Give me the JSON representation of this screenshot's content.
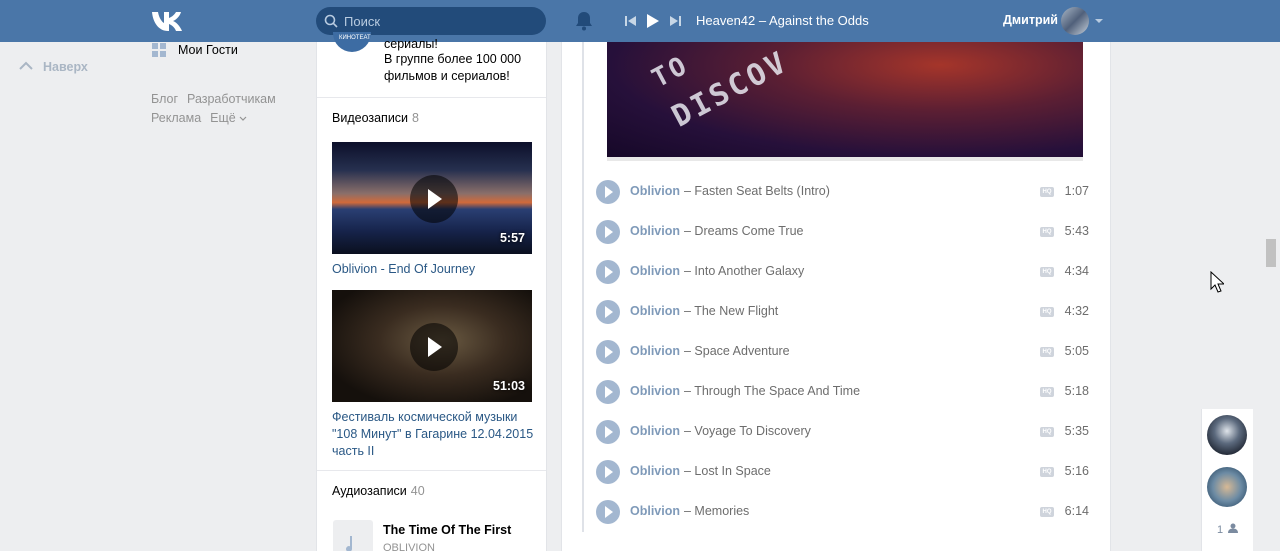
{
  "header": {
    "search_placeholder": "Поиск",
    "now_playing": "Heaven42 – Against the Odds",
    "user_name": "Дмитрий"
  },
  "left_nav": {
    "guests_label": "Мои Гости",
    "to_top_label": "Наверх",
    "footer_links": [
      "Блог",
      "Разработчикам",
      "Реклама",
      "Ещё"
    ]
  },
  "group": {
    "cut_line": "сериалы!",
    "description": "В группе более 100 000 фильмов и сериалов!"
  },
  "videos": {
    "title": "Видеозаписи",
    "count": "8",
    "items": [
      {
        "duration": "5:57",
        "title": "Oblivion - End Of Journey"
      },
      {
        "duration": "51:03",
        "title": "Фестиваль космической музыки \"108 Минут\" в Гагарине 12.04.2015 часть II"
      }
    ]
  },
  "audios": {
    "title": "Аудиозаписи",
    "count": "40",
    "first": {
      "title": "The Time Of The First",
      "artist": "OBLIVION"
    }
  },
  "playlist": {
    "cover_text": [
      "TO",
      "DISCOV"
    ],
    "tracks": [
      {
        "artist": "Oblivion",
        "title": "– Fasten Seat Belts (Intro)",
        "time": "1:07",
        "hq": "HQ"
      },
      {
        "artist": "Oblivion",
        "title": "– Dreams Come True",
        "time": "5:43",
        "hq": "HQ"
      },
      {
        "artist": "Oblivion",
        "title": "– Into Another Galaxy",
        "time": "4:34",
        "hq": "HQ"
      },
      {
        "artist": "Oblivion",
        "title": "– The New Flight",
        "time": "4:32",
        "hq": "HQ"
      },
      {
        "artist": "Oblivion",
        "title": "– Space Adventure",
        "time": "5:05",
        "hq": "HQ"
      },
      {
        "artist": "Oblivion",
        "title": "– Through The Space And Time",
        "time": "5:18",
        "hq": "HQ"
      },
      {
        "artist": "Oblivion",
        "title": "– Voyage To Discovery",
        "time": "5:35",
        "hq": "HQ"
      },
      {
        "artist": "Oblivion",
        "title": "– Lost In Space",
        "time": "5:16",
        "hq": "HQ"
      },
      {
        "artist": "Oblivion",
        "title": "– Memories",
        "time": "6:14",
        "hq": "HQ"
      }
    ]
  },
  "chat": {
    "online_count": "1"
  },
  "colors": {
    "header_bg": "#4a76a8",
    "link": "#2a5885",
    "artist": "#7f9ab9",
    "play_button": "#a3b7d0"
  }
}
